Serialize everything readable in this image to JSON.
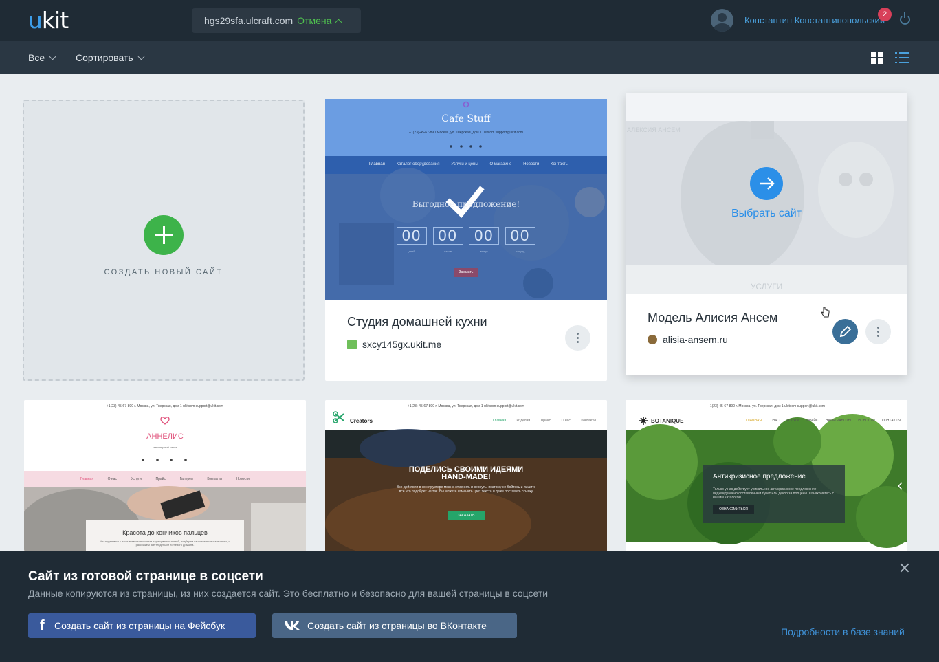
{
  "header": {
    "logo_u": "u",
    "logo_rest": "kit",
    "publish_domain": "hgs29sfa.ulcraft.com",
    "publish_cancel": "Отмена",
    "user_name": "Константин Константинопольский",
    "notifications_count": "2"
  },
  "filters": {
    "all_label": "Все",
    "sort_label": "Сортировать"
  },
  "create_site": {
    "label": "СОЗДАТЬ НОВЫЙ САЙТ"
  },
  "sites": [
    {
      "title": "Студия домашней кухни",
      "url": "sxcy145gx.ukit.me",
      "preview": {
        "brand": "Cafe Stuff",
        "contacts": "+1(23)-45-67-890   Москва, ул. Тверская, дом 1   ukitcom   support@ukit.com",
        "nav": [
          "Главная",
          "Каталог оборудования",
          "Услуги и цены",
          "О магазине",
          "Новости",
          "Контакты"
        ],
        "headline": "Выгодное предложение!",
        "timer": [
          "00",
          "00",
          "00",
          "00"
        ],
        "timer_labels": [
          "дней",
          "часов",
          "минут",
          "секунд"
        ],
        "cta": "Заказать"
      }
    },
    {
      "title": "Модель Алисия Ансем",
      "url": "alisia-ansem.ru",
      "select_label": "Выбрать сайт",
      "preview": {
        "brand": "АЛЕКСИЯ АНСЕМ",
        "section": "УСЛУГИ"
      }
    },
    {
      "preview": {
        "contacts": "+1(23)-45-67-890   г. Москва, ул. Тверская, дом 1   ukitcom   support@ukit.com",
        "brand": "АННЕЛИС",
        "subtitle": "маникюрный салон",
        "nav": [
          "Главная",
          "О нас",
          "Услуги",
          "Прайс",
          "Галерея",
          "Контакты",
          "Новости"
        ],
        "headline": "Красота до кончиков пальцев",
        "text": "Мы поделимся с вами всеми тонкостями наращивания ногтей, подберем качественные материалы, и расскажем все тенденции ногтевого дизайна."
      }
    },
    {
      "preview": {
        "contacts": "+1(23)-45-67-890   г. Москва, ул. Тверская, дом 1   ukitcom   support@ukit.com",
        "brand": "Creators",
        "nav": [
          "Главная",
          "Изделия",
          "Прайс",
          "О нас",
          "Контакты"
        ],
        "headline": "ПОДЕЛИСЬ СВОИМИ ИДЕЯМИ HAND-MADE!",
        "text": "Все действия в конструкторе можно отменить и вернуть, поэтому не бойтесь и пишите все что подойдет не так. Вы можете изменить цвет текста и даже поставить ссылку",
        "cta": "ЗАКАЗАТЬ"
      }
    },
    {
      "preview": {
        "contacts": "+1(23)-45-67-890   г. Москва, ул. Тверская, дом 1   ukitcom   support@ukit.com",
        "brand": "BOTANIQUE",
        "nav": [
          "ГЛАВНАЯ",
          "О НАС",
          "УСЛУГИ",
          "ПРАЙС",
          "НАШИ РАБОТЫ",
          "НОВОСТИ",
          "КОНТАКТЫ"
        ],
        "headline": "Антикризисное предложение",
        "text": "Только у нас действует уникальное антикризисное предложение — индивидуально составленный букет или декор за полцены. Ознакомьтесь с нашим каталогом.",
        "cta": "ОЗНАКОМИТЬСЯ"
      }
    }
  ],
  "social_banner": {
    "title": "Сайт из готовой странице в соцсети",
    "description": "Данные копируются из страницы, из них создается сайт. Это бесплатно и безопасно для вашей страницы в соцсети",
    "facebook_button": "Создать сайт из страницы на Фейсбук",
    "vk_button": "Создать сайт из страницы во ВКонтакте",
    "kb_link": "Подробности в базе знаний"
  },
  "colors": {
    "accent_blue": "#3d9de8",
    "green": "#3db34a",
    "topbar": "#1f2b35",
    "badge": "#d8405a"
  }
}
